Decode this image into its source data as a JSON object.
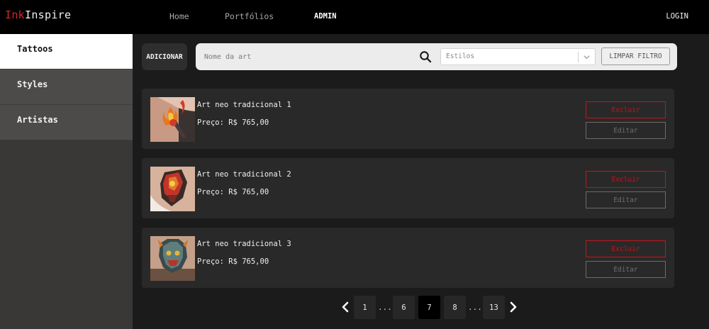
{
  "brand": {
    "prefix": "Ink",
    "name": "Inspire",
    "accent": "#d8232a"
  },
  "nav": {
    "home": "Home",
    "portfolios": "Portfólios",
    "admin": "ADMIN",
    "login": "LOGIN"
  },
  "sidebar": {
    "items": [
      {
        "label": "Tattoos",
        "active": true
      },
      {
        "label": "Styles",
        "active": false
      },
      {
        "label": "Artistas",
        "active": false
      }
    ]
  },
  "toolbar": {
    "add_label": "ADICIONAR",
    "search_placeholder": "Nome da art",
    "search_value": "",
    "styles_placeholder": "Estilos",
    "clear_label": "LIMPAR FILTRO"
  },
  "cards": [
    {
      "title": "Art neo tradicional 1",
      "price": "Preço: R$ 765,00",
      "delete_label": "Excluir",
      "edit_label": "Editar",
      "image": "tattoo-torch-image"
    },
    {
      "title": "Art neo tradicional 2",
      "price": "Preço: R$ 765,00",
      "delete_label": "Excluir",
      "edit_label": "Editar",
      "image": "tattoo-ornament-image"
    },
    {
      "title": "Art neo tradicional 3",
      "price": "Preço: R$ 765,00",
      "delete_label": "Excluir",
      "edit_label": "Editar",
      "image": "tattoo-beast-image"
    }
  ],
  "pagination": {
    "pages": [
      "1",
      "6",
      "7",
      "8",
      "13"
    ],
    "current": "7",
    "ellipsis": "...",
    "prev_icon": "chevron-left-icon",
    "next_icon": "chevron-right-icon"
  }
}
